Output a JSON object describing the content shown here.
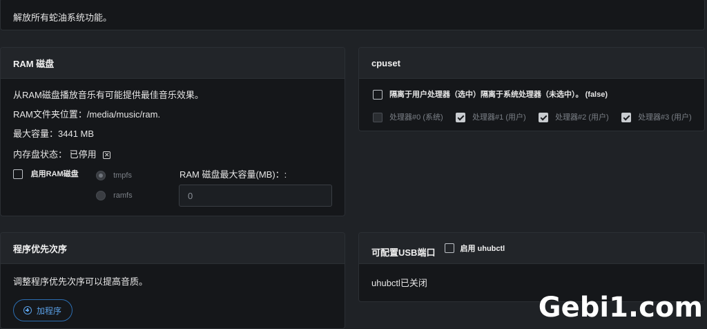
{
  "top_panel": {
    "text": "解放所有蛇油系统功能。"
  },
  "ram_panel": {
    "title": "RAM 磁盘",
    "desc": "从RAM磁盘播放音乐有可能提供最佳音乐效果。",
    "folder_line": "RAM文件夹位置：/media/music/ram.",
    "max_capacity_line": "最大容量：3441 MB",
    "status_label": "内存盘状态：",
    "status_value": "已停用",
    "status_icon": "x-box-icon",
    "enable_label": "启用RAM磁盘",
    "enable_checked": false,
    "fs_options": [
      "tmpfs",
      "ramfs"
    ],
    "fs_selected": "tmpfs",
    "max_size_label": "RAM 磁盘最大容量(MB)：:",
    "max_size_value": "0"
  },
  "cpuset_panel": {
    "title": "cpuset",
    "isolate_label": "隔离于用户处理器（选中）隔离于系统处理器（未选中）。 (false)",
    "isolate_checked": false,
    "processors": [
      {
        "label": "处理器#0 (系统)",
        "checked": false,
        "disabled": true
      },
      {
        "label": "处理器#1 (用户)",
        "checked": true,
        "disabled": false
      },
      {
        "label": "处理器#2 (用户)",
        "checked": true,
        "disabled": false
      },
      {
        "label": "处理器#3 (用户)",
        "checked": true,
        "disabled": false
      }
    ]
  },
  "priority_panel": {
    "title": "程序优先次序",
    "desc": "调整程序优先次序可以提高音质。",
    "add_button": "加程序"
  },
  "usb_panel": {
    "title": "可配置USB端口",
    "enable_label": "启用 uhubctl",
    "enable_checked": false,
    "status": "uhubctl已关闭"
  },
  "watermark": "Gebi1.com",
  "colors": {
    "accent": "#5aa0e6",
    "panel_bg": "#15171a",
    "header_bg": "#222529",
    "page_bg": "#1f2226"
  }
}
